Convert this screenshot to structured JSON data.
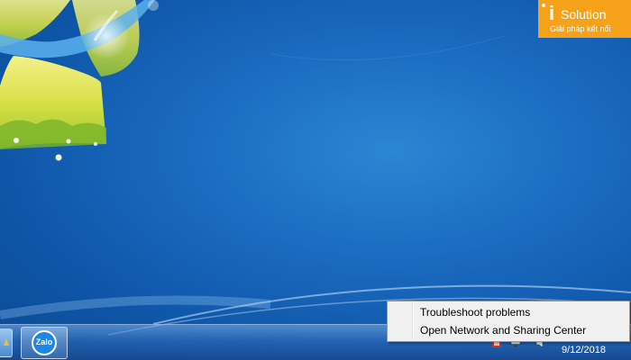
{
  "watermark": {
    "brand_i": "i",
    "brand_word": "Solution",
    "tagline": "Giải pháp kết nối"
  },
  "taskbar": {
    "pinned_app": {
      "label": "Zalo",
      "icon": "zalo-icon"
    },
    "tray": {
      "icons": [
        "flag-icon",
        "network-icon",
        "volume-icon"
      ],
      "clock_date": "9/12/2018"
    }
  },
  "context_menu": {
    "items": [
      {
        "label": "Troubleshoot problems"
      },
      {
        "label": "Open Network and Sharing Center"
      }
    ]
  },
  "colors": {
    "desktop_blue": "#1b6cc2",
    "logo_orange": "#f5a11a",
    "menu_bg": "#f0f0f0"
  }
}
